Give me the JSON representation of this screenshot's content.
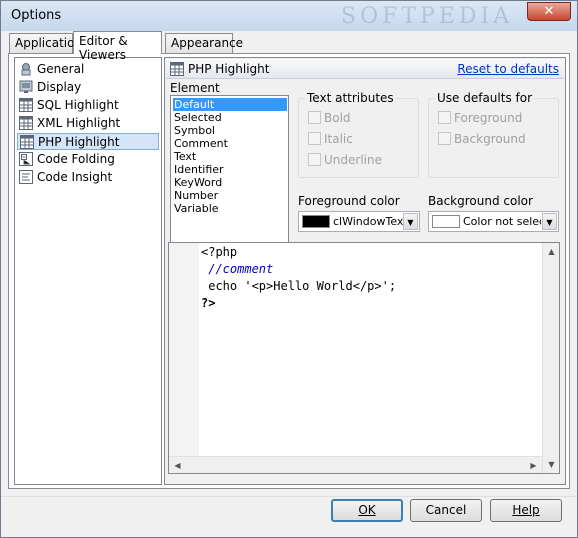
{
  "window": {
    "title": "Options",
    "close_glyph": "✕",
    "watermark": "SOFTPEDIA"
  },
  "tabs": [
    {
      "label": "Application"
    },
    {
      "label": "Editor & Viewers",
      "active": true
    },
    {
      "label": "Appearance"
    }
  ],
  "categories": [
    {
      "label": "General",
      "icon": "general-icon"
    },
    {
      "label": "Display",
      "icon": "display-icon"
    },
    {
      "label": "SQL Highlight",
      "icon": "grid-icon"
    },
    {
      "label": "XML Highlight",
      "icon": "grid-icon"
    },
    {
      "label": "PHP Highlight",
      "icon": "grid-icon",
      "selected": true
    },
    {
      "label": "Code Folding",
      "icon": "code-folding-icon"
    },
    {
      "label": "Code Insight",
      "icon": "code-insight-icon"
    }
  ],
  "panel": {
    "title": "PHP Highlight",
    "reset_label": "Reset to defaults",
    "element_label": "Element",
    "elements": [
      "Default",
      "Selected",
      "Symbol",
      "Comment",
      "Text",
      "Identifier",
      "KeyWord",
      "Number",
      "Variable"
    ],
    "selected_element": "Default",
    "text_attributes": {
      "title": "Text attributes",
      "bold": "Bold",
      "italic": "Italic",
      "underline": "Underline"
    },
    "use_defaults": {
      "title": "Use defaults for",
      "foreground": "Foreground",
      "background": "Background"
    },
    "foreground_color": {
      "label": "Foreground color",
      "value": "clWindowText",
      "swatch": "#000000"
    },
    "background_color": {
      "label": "Background color",
      "value": "Color not selected",
      "swatch": "#ffffff"
    },
    "code": [
      "<?php",
      " //comment",
      " echo '<p>Hello World</p>';",
      "?>"
    ]
  },
  "buttons": {
    "ok": "OK",
    "cancel": "Cancel",
    "help": "Help"
  },
  "colors": {
    "link": "#0033cc",
    "selection": "#3399ff",
    "comment": "#0000cc"
  }
}
